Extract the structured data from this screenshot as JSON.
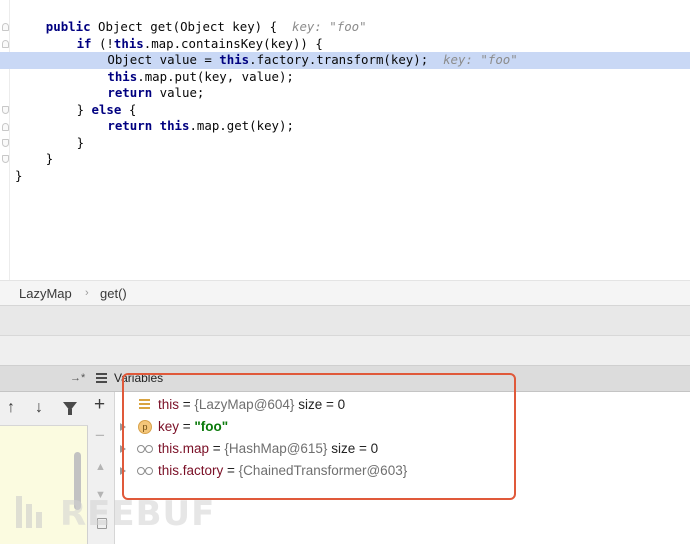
{
  "editor": {
    "code_lines": [
      {
        "indent": 4,
        "parts": [
          {
            "t": "public",
            "c": "kw"
          },
          {
            "t": " Object get(Object key) { "
          },
          {
            "t": " key: \"foo\"",
            "c": "hint"
          }
        ]
      },
      {
        "indent": 8,
        "parts": [
          {
            "t": "if",
            "c": "kw"
          },
          {
            "t": " (!"
          },
          {
            "t": "this",
            "c": "kw"
          },
          {
            "t": ".map.containsKey(key)) {"
          }
        ]
      },
      {
        "indent": 12,
        "current": true,
        "parts": [
          {
            "t": "Object value = "
          },
          {
            "t": "this",
            "c": "kw"
          },
          {
            "t": ".factory.transform(key); "
          },
          {
            "t": " key: \"foo\"",
            "c": "hint"
          }
        ]
      },
      {
        "indent": 12,
        "parts": [
          {
            "t": "this",
            "c": "kw"
          },
          {
            "t": ".map.put(key, value);"
          }
        ]
      },
      {
        "indent": 12,
        "parts": [
          {
            "t": "return",
            "c": "kw"
          },
          {
            "t": " value;"
          }
        ]
      },
      {
        "indent": 8,
        "parts": [
          {
            "t": "} "
          },
          {
            "t": "else",
            "c": "kw"
          },
          {
            "t": " {"
          }
        ]
      },
      {
        "indent": 12,
        "parts": [
          {
            "t": "return",
            "c": "kw"
          },
          {
            "t": " "
          },
          {
            "t": "this",
            "c": "kw"
          },
          {
            "t": ".map.get(key);"
          }
        ]
      },
      {
        "indent": 8,
        "parts": [
          {
            "t": "}"
          }
        ]
      },
      {
        "indent": 4,
        "parts": [
          {
            "t": "}"
          }
        ]
      },
      {
        "indent": 0,
        "parts": [
          {
            "t": "}"
          }
        ]
      }
    ]
  },
  "breadcrumb": {
    "class_name": "LazyMap",
    "separator": "›",
    "method": "get()"
  },
  "debugger": {
    "panel_title": "Variables",
    "restore_icon_glyph": "→*",
    "frames_toolbar": {
      "up_glyph": "↑",
      "down_glyph": "↓"
    },
    "vars_toolbar": {
      "add_glyph": "+",
      "remove_glyph": "−",
      "move_up_glyph": "▲",
      "move_down_glyph": "▼"
    },
    "variables": [
      {
        "icon": "field-icon",
        "expandable": false,
        "name": "this",
        "eq": " = ",
        "value": "{LazyMap@604}",
        "extra": "  size = 0"
      },
      {
        "icon": "parameter-icon",
        "icon_letter": "p",
        "expandable": true,
        "name": "key",
        "eq": " = ",
        "value_str": "\"foo\""
      },
      {
        "icon": "watch-icon",
        "expandable": true,
        "name": "this.map",
        "eq": " = ",
        "value": "{HashMap@615}",
        "extra": "  size = 0"
      },
      {
        "icon": "watch-icon",
        "expandable": true,
        "name": "this.factory",
        "eq": " = ",
        "value": "{ChainedTransformer@603}"
      }
    ]
  },
  "watermark": {
    "text": "REEBUF"
  },
  "colors": {
    "current_line": "#c9d8f5",
    "keyword": "#000080",
    "highlight_box": "#e0593a",
    "var_name": "#7a0f26",
    "string_value": "#0b7a0b"
  }
}
